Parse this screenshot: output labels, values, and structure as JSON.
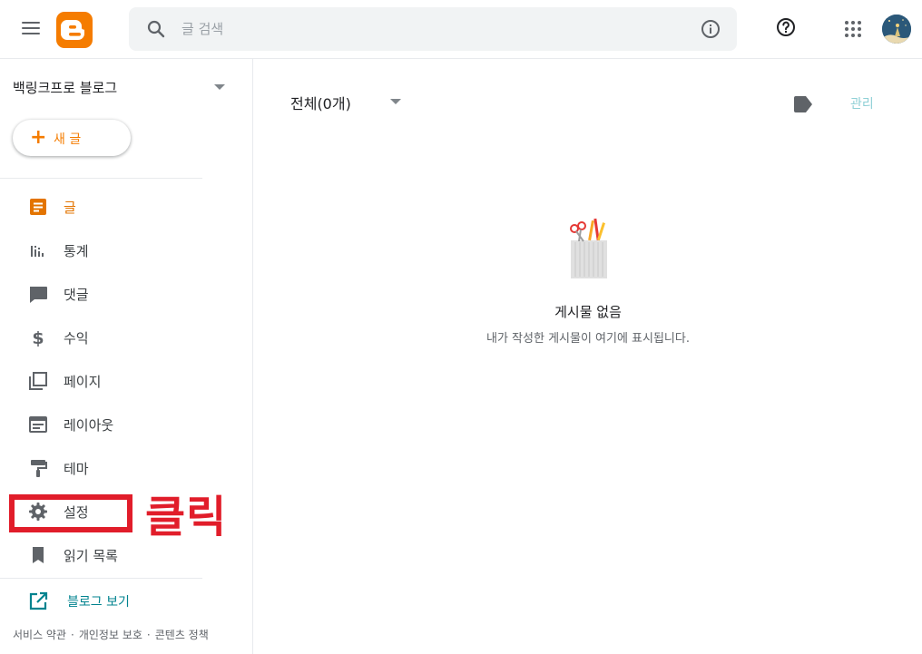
{
  "header": {
    "search_placeholder": "글 검색",
    "colors": {
      "brand": "#f57c00",
      "search_bg": "#f1f3f4"
    },
    "icons": [
      "menu-icon",
      "blogger-logo",
      "search-icon",
      "info-icon",
      "help-icon",
      "apps-icon",
      "avatar"
    ]
  },
  "sidebar": {
    "blog_name": "백링크프로 블로그",
    "new_post_label": "새 글",
    "items": [
      {
        "label": "글",
        "icon": "posts-icon",
        "active": true
      },
      {
        "label": "통계",
        "icon": "stats-icon"
      },
      {
        "label": "댓글",
        "icon": "comments-icon"
      },
      {
        "label": "수익",
        "icon": "earnings-icon"
      },
      {
        "label": "페이지",
        "icon": "pages-icon"
      },
      {
        "label": "레이아웃",
        "icon": "layout-icon"
      },
      {
        "label": "테마",
        "icon": "theme-icon"
      },
      {
        "label": "설정",
        "icon": "settings-icon"
      },
      {
        "label": "읽기 목록",
        "icon": "reading-list-icon"
      }
    ],
    "view_blog_label": "블로그 보기",
    "footer": {
      "terms": "서비스 약관",
      "privacy": "개인정보 보호",
      "content_policy": "콘텐츠 정책",
      "separator": "·"
    },
    "active_color": "#e37400"
  },
  "annotation": {
    "click_text": "클릭",
    "color": "#e11d2a"
  },
  "main": {
    "filter_label": "전체(0개)",
    "manage_label": "관리",
    "empty_title": "게시물 없음",
    "empty_subtitle": "내가 작성한 게시물이 여기에 표시됩니다."
  }
}
